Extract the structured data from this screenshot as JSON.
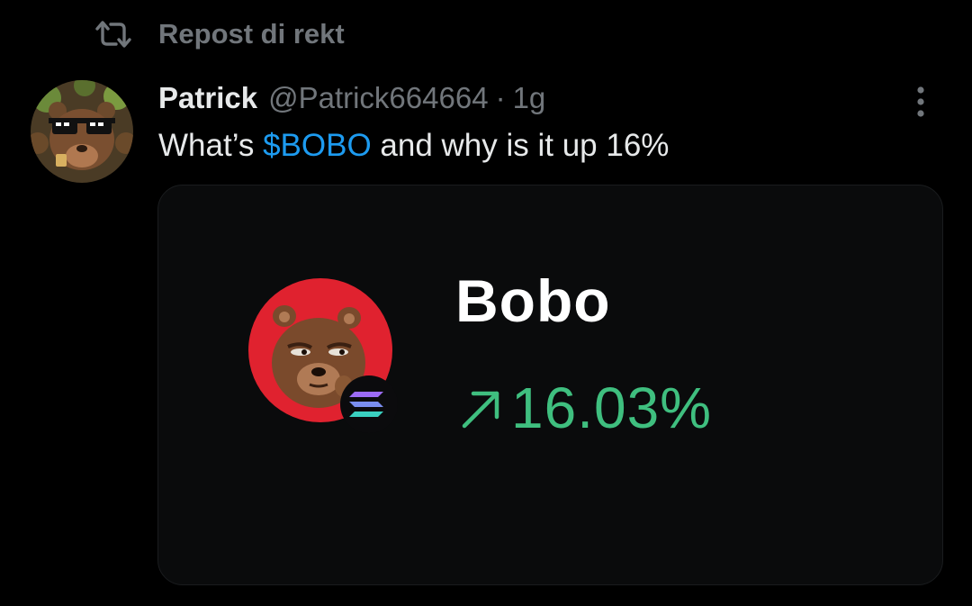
{
  "repost": {
    "icon": "repost-icon",
    "label": "Repost di rekt"
  },
  "post": {
    "author": {
      "display_name": "Patrick",
      "handle": "@Patrick664664",
      "separator": "·",
      "time": "1g",
      "avatar": "bear-with-sunglasses-avatar"
    },
    "more_icon": "more-vertical-icon",
    "text": {
      "before": "What’s ",
      "cashtag": "$BOBO",
      "after": " and why is it up 16%"
    },
    "media": {
      "token_name": "Bobo",
      "change_value": "16.03%",
      "change_icon": "arrow-up-right-icon",
      "logo": "bobo-bear-token-logo",
      "chain_badge": "solana-icon"
    }
  },
  "colors": {
    "background": "#000000",
    "text_primary": "#e7e9ea",
    "text_secondary": "#71767b",
    "cashtag": "#1d9bf0",
    "positive": "#3fbf7f",
    "logo_red": "#e0222f",
    "card_bg": "#0a0b0c"
  }
}
